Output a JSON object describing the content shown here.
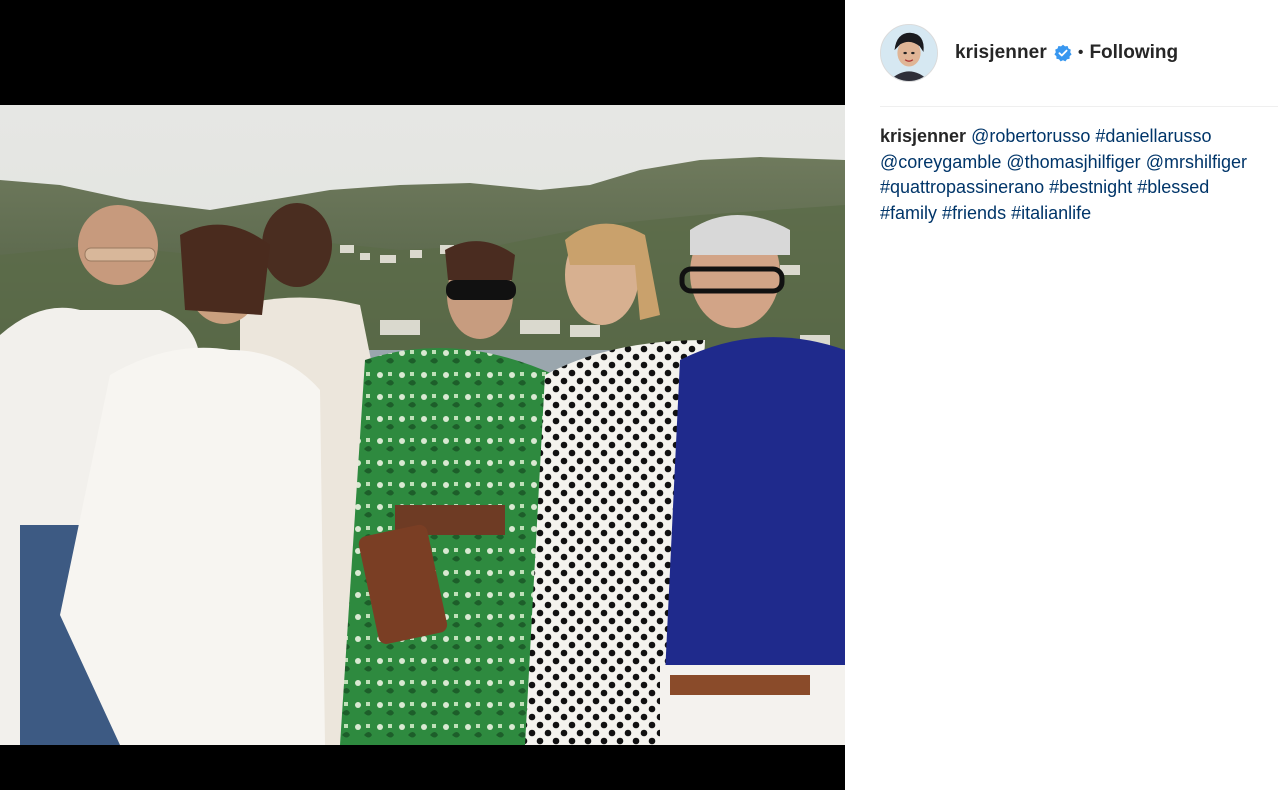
{
  "post": {
    "username": "krisjenner",
    "verified_icon": "verified-badge-icon",
    "separator": "•",
    "follow_status": "Following",
    "caption": {
      "author": "krisjenner",
      "tokens": [
        {
          "text": "@robertorusso",
          "type": "mention"
        },
        {
          "text": "#daniellarusso",
          "type": "hashtag"
        },
        {
          "text": "@coreygamble",
          "type": "mention"
        },
        {
          "text": "@thomasjhilfiger",
          "type": "mention"
        },
        {
          "text": "@mrshilfiger",
          "type": "mention"
        },
        {
          "text": "#quattropassinerano",
          "type": "hashtag"
        },
        {
          "text": "#bestnight",
          "type": "hashtag"
        },
        {
          "text": "#blessed",
          "type": "hashtag"
        },
        {
          "text": "#family",
          "type": "hashtag"
        },
        {
          "text": "#friends",
          "type": "hashtag"
        },
        {
          "text": "#italianlife",
          "type": "hashtag"
        }
      ]
    }
  },
  "colors": {
    "link": "#003569",
    "text": "#262626",
    "verified": "#3897f0",
    "divider": "#efefef"
  }
}
